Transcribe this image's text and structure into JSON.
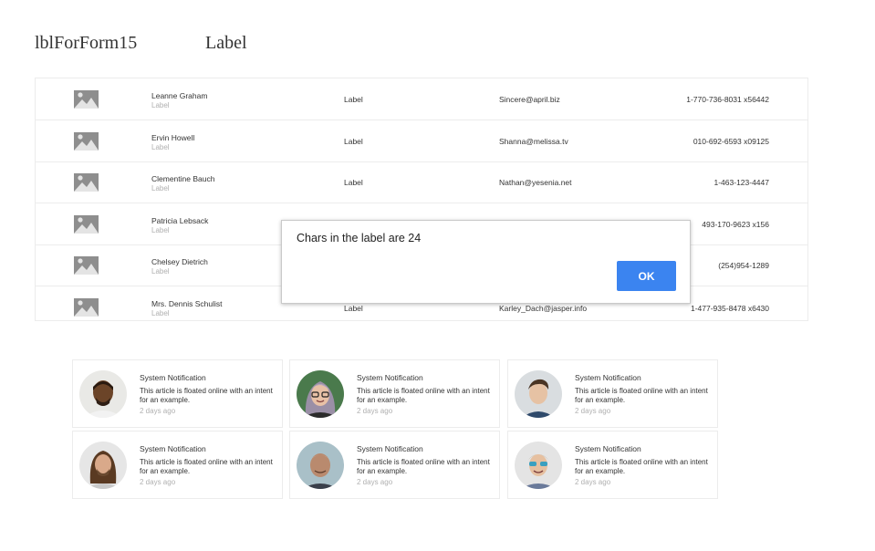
{
  "header": {
    "form_label": "lblForForm15",
    "label": "Label"
  },
  "users": [
    {
      "name": "Leanne Graham",
      "sub": "Label",
      "label": "Label",
      "email": "Sincere@april.biz",
      "phone": "1-770-736-8031 x56442"
    },
    {
      "name": "Ervin Howell",
      "sub": "Label",
      "label": "Label",
      "email": "Shanna@melissa.tv",
      "phone": "010-692-6593 x09125"
    },
    {
      "name": "Clementine Bauch",
      "sub": "Label",
      "label": "Label",
      "email": "Nathan@yesenia.net",
      "phone": "1-463-123-4447"
    },
    {
      "name": "Patricia Lebsack",
      "sub": "Label",
      "label": "",
      "email": "",
      "phone": "493-170-9623 x156"
    },
    {
      "name": "Chelsey Dietrich",
      "sub": "Label",
      "label": "",
      "email": "",
      "phone": "(254)954-1289"
    },
    {
      "name": "Mrs. Dennis Schulist",
      "sub": "Label",
      "label": "Label",
      "email": "Karley_Dach@jasper.info",
      "phone": "1-477-935-8478 x6430"
    }
  ],
  "dialog": {
    "message": "Chars in the label are 24",
    "ok_label": "OK"
  },
  "notifications": [
    {
      "title": "System Notification",
      "body": "This article is floated online with an intent for an example.",
      "time": "2 days ago"
    },
    {
      "title": "System Notification",
      "body": "This article is floated online with an intent for an example.",
      "time": "2 days ago"
    },
    {
      "title": "System Notification",
      "body": "This article is floated online with an intent for an example.",
      "time": "2 days ago"
    },
    {
      "title": "System Notification",
      "body": "This article is floated online with an intent for an example.",
      "time": "2 days ago"
    },
    {
      "title": "System Notification",
      "body": "This article is floated online with an intent for an example.",
      "time": "2 days ago"
    },
    {
      "title": "System Notification",
      "body": "This article is floated online with an intent for an example.",
      "time": "2 days ago"
    }
  ],
  "colors": {
    "accent": "#3b84f0",
    "placeholder_icon": "#8e8e8e",
    "muted_text": "#b0b0b0",
    "border": "#ececec"
  }
}
